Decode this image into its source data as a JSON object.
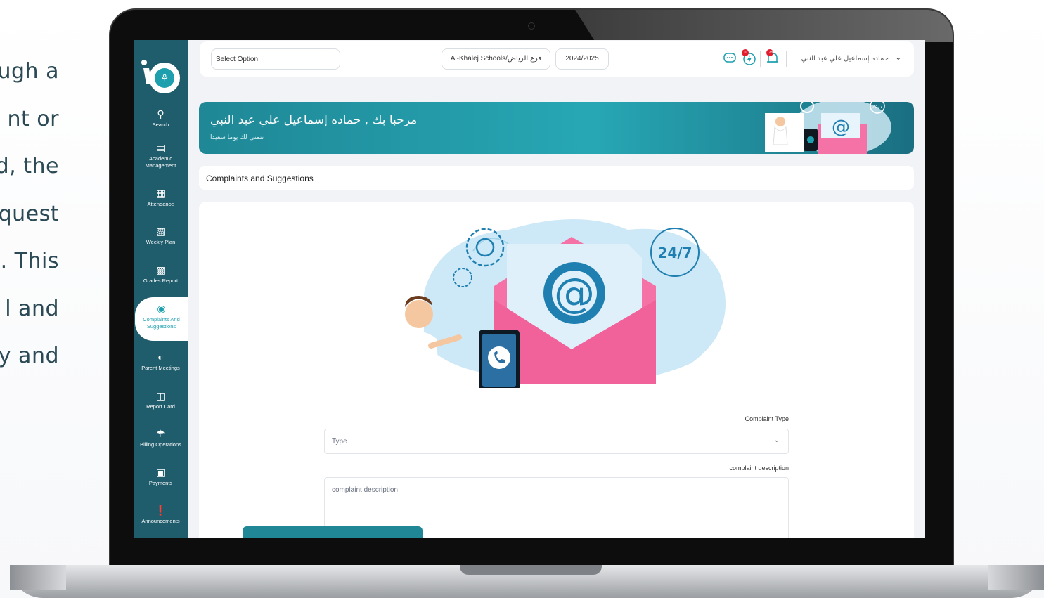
{
  "background_text": [
    "ugh a",
    "nt or",
    "d, the",
    "quest",
    ". This",
    "l and",
    "y and"
  ],
  "sidebar": {
    "items": [
      {
        "icon": "search-icon",
        "label": "Search"
      },
      {
        "icon": "academic-icon",
        "label": "Academic Management"
      },
      {
        "icon": "calendar-icon",
        "label": "Attendance"
      },
      {
        "icon": "plan-icon",
        "label": "Weekly Plan"
      },
      {
        "icon": "report-icon",
        "label": "Grades Report"
      },
      {
        "icon": "question-icon",
        "label": "Complaints And Suggestions",
        "active": true
      },
      {
        "icon": "meeting-icon",
        "label": "Parent Meetings"
      },
      {
        "icon": "card-icon",
        "label": "Report Card"
      },
      {
        "icon": "billing-icon",
        "label": "Billing Operations"
      },
      {
        "icon": "payments-icon",
        "label": "Payments"
      },
      {
        "icon": "announcement-icon",
        "label": "Announcements"
      }
    ]
  },
  "header": {
    "select_placeholder": "Select Option",
    "branch": "Al-Khalej Schools/فرع الرياض",
    "year": "2024/2025",
    "notification_badge": "0",
    "alerts_badge": "128",
    "user_name": "حماده إسماعيل علي عبد النبي"
  },
  "banner": {
    "title": "مرحبا بك , حماده إسماعيل علي عبد النبي",
    "subtitle": "نتمنى لك يوما سعيدا",
    "art_badge": "24/7"
  },
  "page": {
    "title": "Complaints and Suggestions",
    "hero_badge": "24/7"
  },
  "form": {
    "type_label": "Complaint Type",
    "type_placeholder": "Type",
    "description_label": "complaint description",
    "description_placeholder": "complaint description"
  },
  "colors": {
    "sidebar": "#1f5c6c",
    "accent": "#1f8796",
    "envelope": "#f472a6",
    "badge": "#e11d2e"
  }
}
